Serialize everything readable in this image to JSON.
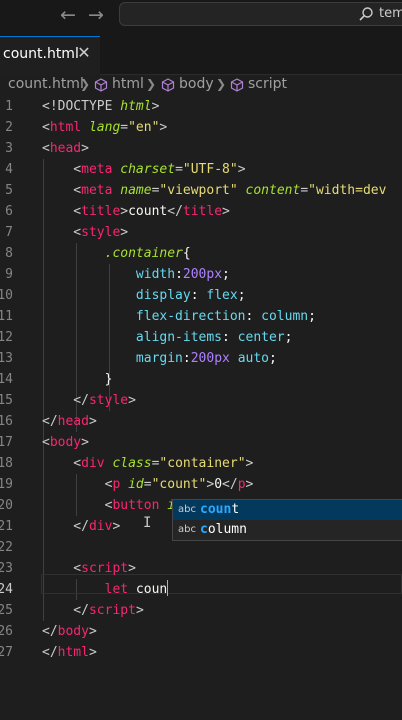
{
  "titlebar": {
    "back_glyph": "←",
    "forward_glyph": "→",
    "search_text": "tem"
  },
  "tab": {
    "label": "count.html",
    "close_glyph": "✕"
  },
  "breadcrumb": {
    "file": "count.html",
    "sep": "❯",
    "items": [
      "html",
      "body",
      "script"
    ]
  },
  "editor": {
    "line_numbers": [
      "1",
      "2",
      "3",
      "4",
      "5",
      "6",
      "7",
      "8",
      "9",
      "10",
      "11",
      "12",
      "13",
      "14",
      "15",
      "16",
      "17",
      "18",
      "19",
      "20",
      "21",
      "22",
      "23",
      "24",
      "25",
      "26",
      "27"
    ],
    "active_line": "24"
  },
  "autocomplete": {
    "items": [
      {
        "kind": "abc",
        "match": "coun",
        "rest": "t",
        "label": "count"
      },
      {
        "kind": "abc",
        "match": "c",
        "rest": "olumn",
        "label": "column"
      }
    ]
  },
  "colors": {
    "background": "#1e1e1e",
    "tag": "#f92672",
    "attribute": "#a6e22e",
    "string": "#e6db74",
    "number": "#ae81ff",
    "property": "#66d9ef",
    "accent": "#0078d4"
  },
  "icons": [
    "arrow-left-icon",
    "arrow-right-icon",
    "search-icon",
    "close-icon",
    "chevron-right-icon",
    "cube-icon"
  ]
}
